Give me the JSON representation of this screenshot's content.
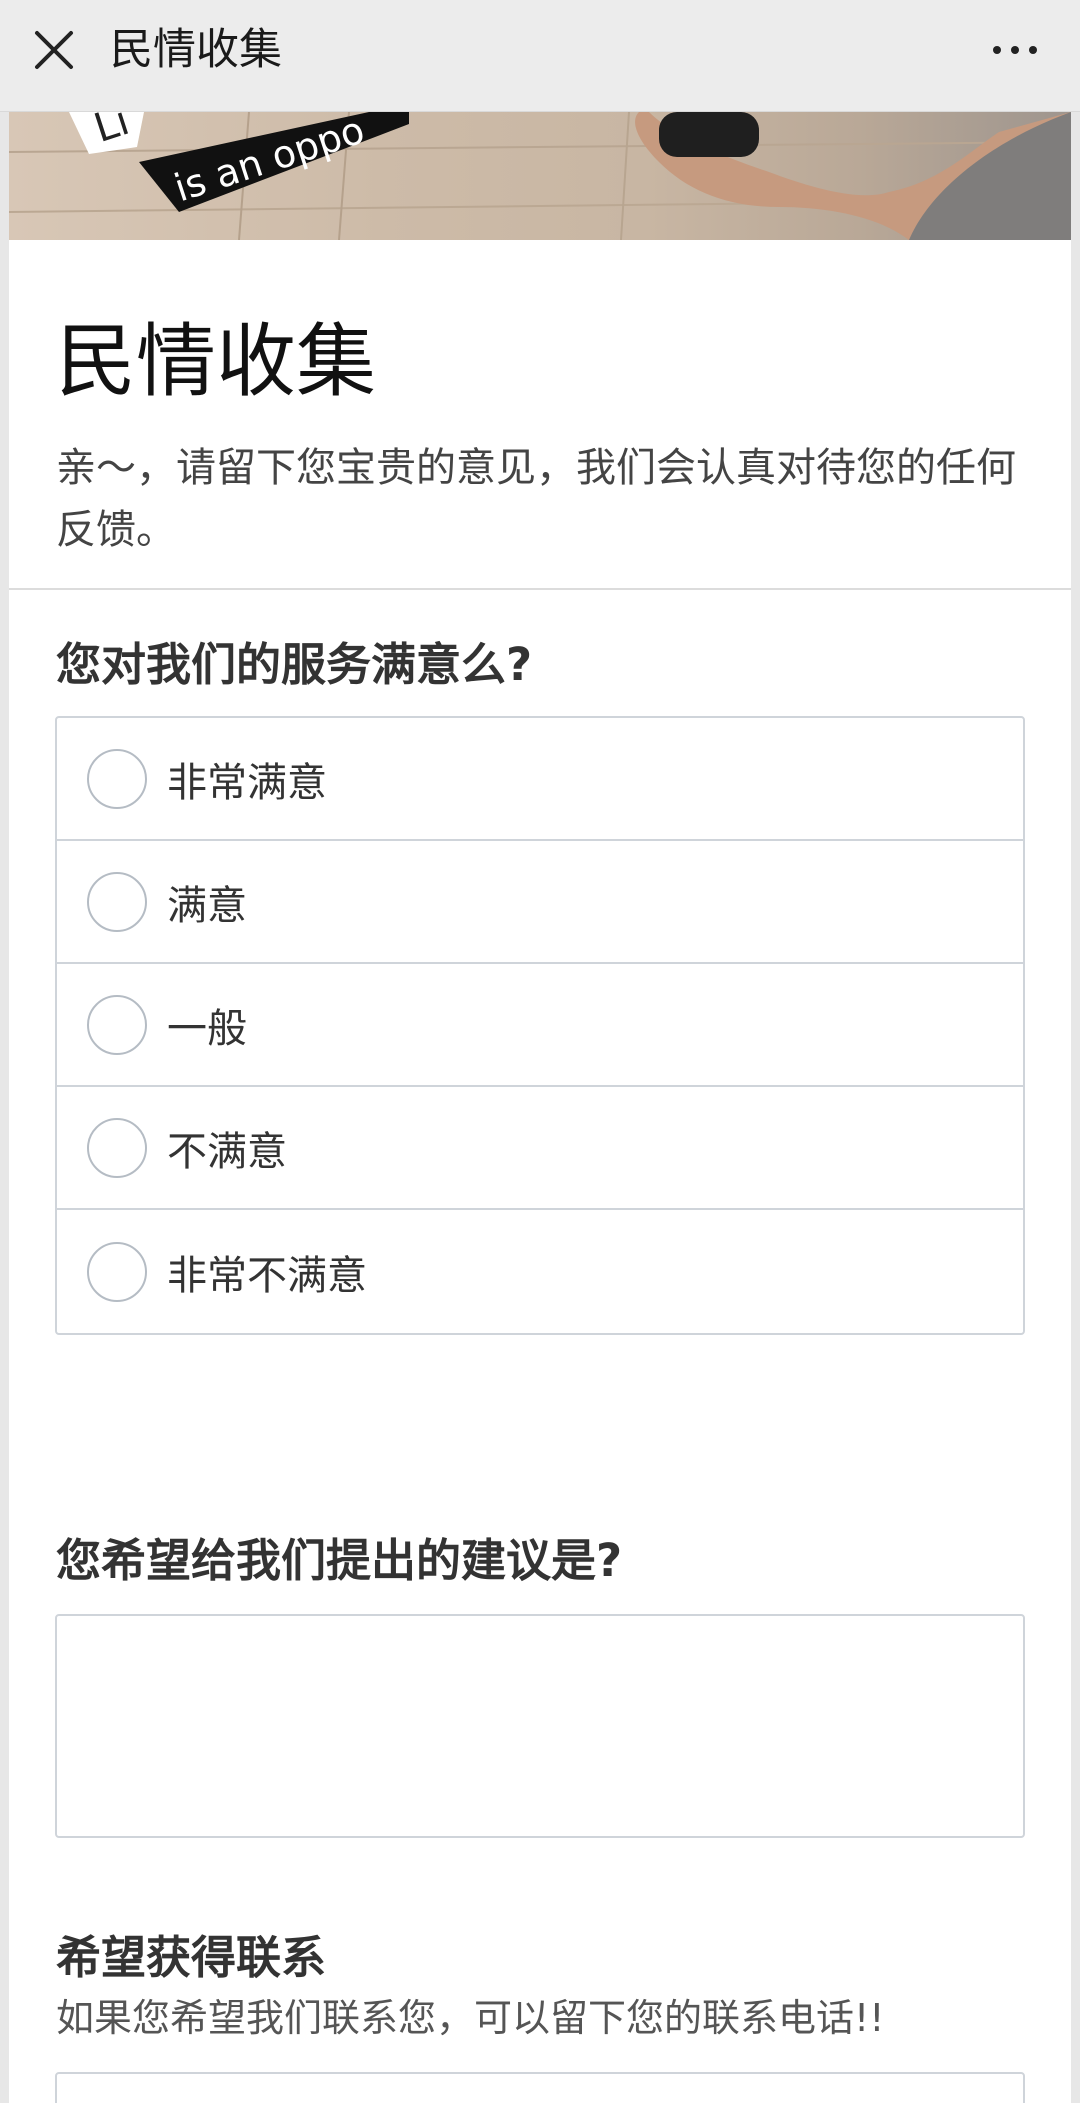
{
  "nav": {
    "title": "民情收集",
    "close_icon": "close-icon",
    "more_icon": "more-dots-icon"
  },
  "header_image": {
    "overlay_text_1": "is an oppo",
    "overlay_text_2": "Li",
    "description": "banner photo with hand holding phone on wooden floor"
  },
  "form": {
    "title": "民情收集",
    "description": "亲～，请留下您宝贵的意见，我们会认真对待您的任何反馈。"
  },
  "questions": {
    "satisfaction": {
      "title": "您对我们的服务满意么?",
      "options": [
        {
          "label": "非常满意",
          "selected": false
        },
        {
          "label": "满意",
          "selected": false
        },
        {
          "label": "一般",
          "selected": false
        },
        {
          "label": "不满意",
          "selected": false
        },
        {
          "label": "非常不满意",
          "selected": false
        }
      ]
    },
    "suggestion": {
      "title": "您希望给我们提出的建议是?",
      "value": "",
      "placeholder": ""
    },
    "contact": {
      "title": "希望获得联系",
      "hint": "如果您希望我们联系您，可以留下您的联系电话!!",
      "value": "",
      "placeholder": ""
    }
  },
  "colors": {
    "nav_bg": "#ececec",
    "border": "#cfd4da",
    "radio_border": "#b5bcc4",
    "text": "#333333"
  }
}
